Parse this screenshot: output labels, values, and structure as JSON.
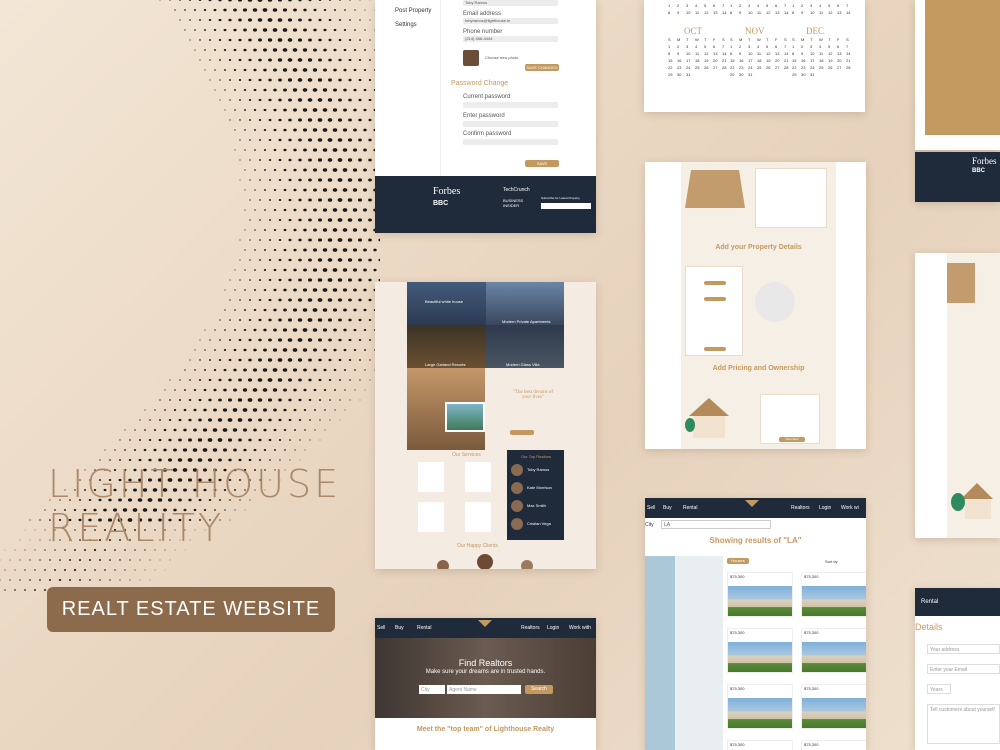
{
  "brand": {
    "title_line1": "LIGHT HOUSE",
    "title_line2": "REALITY",
    "badge": "REALT ESTATE WEBSITE"
  },
  "colors": {
    "gold": "#c4995f",
    "navy": "#1f2a3a",
    "brown_badge": "#8c6a4c",
    "title": "#a9896a"
  },
  "settings_shot": {
    "menu": [
      "Post Property",
      "Settings"
    ],
    "name_value": "Toby Ramos",
    "email_label": "Email address",
    "email_value": "tobyramos@lighthouse.ie",
    "phone_label": "Phone number",
    "phone_value": "(214) 456-4444",
    "choose_photo": "Choose new photo",
    "save_btn": "SAVE CHANGES",
    "password_title": "Password Change",
    "current_pw": "Current password",
    "enter_pw": "Enter password",
    "confirm_pw": "Confirm password",
    "save_pw_btn": "SAVE PASSWORD",
    "press": [
      "Forbes",
      "BBC",
      "TechCrunch",
      "BUSINESS INSIDER"
    ],
    "subscribe": "Subscribe for Latest Property"
  },
  "calendar_shot": {
    "months": [
      "OCT",
      "NOV",
      "DEC"
    ],
    "weekdays": [
      "S",
      "M",
      "T",
      "W",
      "T",
      "F",
      "S"
    ]
  },
  "add_property_shot": {
    "title": "Add your Property Details",
    "pricing_title": "Add Pricing and Ownership",
    "btn": "Next Step"
  },
  "home_shot": {
    "tiles": [
      "Beautiful white house",
      "Modern Private Apartments",
      "Large Garland Resorts",
      "Modern Glass Villa"
    ],
    "quote": "\"The best dreams of your lives\"",
    "services": "Our Services",
    "realtors": "Our Top Realtors",
    "realtor_names": [
      "Toby Ramos",
      "Kate Morrison",
      "Max Smith",
      "Cristian Vega"
    ],
    "clients": "Our Happy Clients"
  },
  "realtors_shot": {
    "nav": [
      "Sell",
      "Buy",
      "Rental",
      "Realtors",
      "Login",
      "Work with"
    ],
    "logo": "LIGHT HOUSE Reality",
    "hero_title": "Find Realtors",
    "hero_sub": "Make sure your dreams are in trusted hands.",
    "city_placeholder": "City",
    "agent_placeholder": "Agent Name",
    "search_btn": "Search",
    "team_title": "Meet the \"top team\" of Lighthouse Realty"
  },
  "results_shot": {
    "nav": [
      "Sell",
      "Buy",
      "Rental",
      "Realtors",
      "Login",
      "Work wi"
    ],
    "city_label": "City",
    "search_value": "LA",
    "heading": "Showing results of \"LA\"",
    "filter": "Houses",
    "sort": "Sort by",
    "prices": [
      "$75,300",
      "$75,300",
      "$75,300",
      "$75,300",
      "$75,300",
      "$75,300",
      "$75,300",
      "$75,300"
    ]
  },
  "contact_shot": {
    "nav": "Rental",
    "title": "Details",
    "email_ph": "Your address",
    "email2_ph": "Enter your Email",
    "years": "Years",
    "about_ph": "Tell customers about yourself"
  }
}
